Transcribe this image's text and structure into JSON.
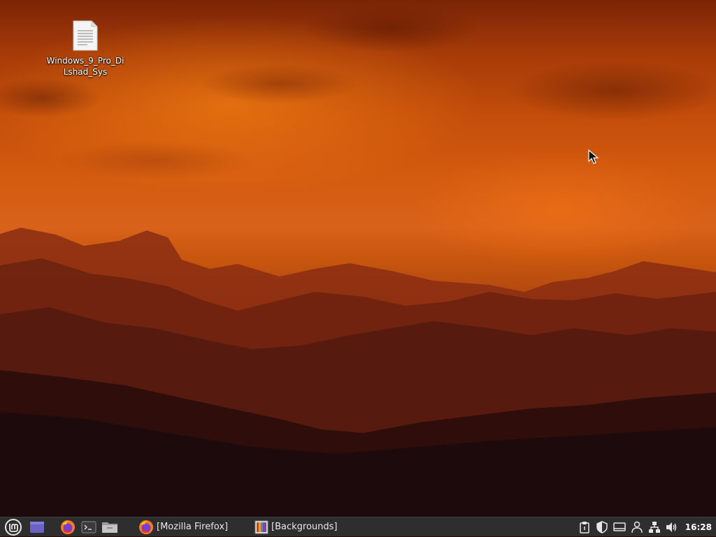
{
  "desktop": {
    "icons": [
      {
        "label": "Windows_9_Pro_DiLshad_Sys",
        "icon": "text-document-icon"
      }
    ]
  },
  "taskbar": {
    "menu_icon": "linux-mint-logo-icon",
    "launchers": [
      {
        "name": "show-desktop",
        "icon": "show-desktop-icon"
      },
      {
        "name": "firefox",
        "icon": "firefox-icon"
      },
      {
        "name": "terminal",
        "icon": "terminal-icon"
      },
      {
        "name": "files",
        "icon": "folder-icon"
      }
    ],
    "windows": [
      {
        "label": "[Mozilla Firefox]",
        "icon": "firefox-icon"
      },
      {
        "label": "[Backgrounds]",
        "icon": "backgrounds-icon"
      }
    ],
    "tray": [
      {
        "icon": "clipboard-icon"
      },
      {
        "icon": "shield-update-icon"
      },
      {
        "icon": "display-icon"
      },
      {
        "icon": "user-icon"
      },
      {
        "icon": "network-icon"
      },
      {
        "icon": "volume-icon"
      }
    ],
    "clock": "16:28"
  },
  "colors": {
    "taskbar_bg": "#2e2e2e",
    "sky_orange": "#d35b10",
    "mint_green": "#8fce4a"
  }
}
